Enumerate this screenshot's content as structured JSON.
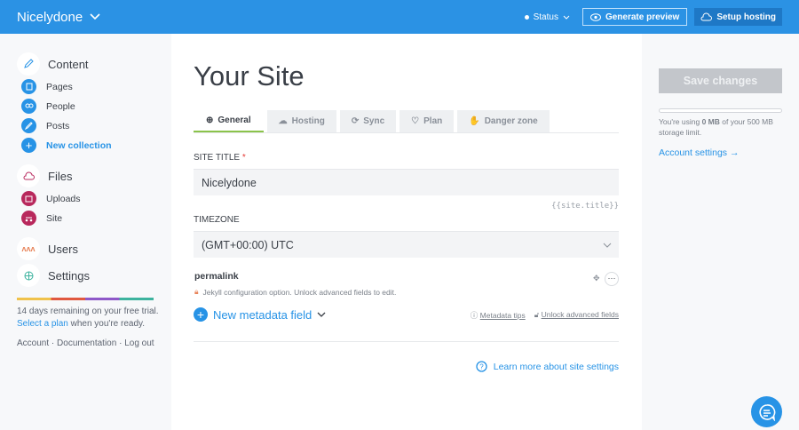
{
  "header": {
    "site_name": "Nicelydone",
    "status": "Status",
    "generate_preview": "Generate preview",
    "setup_hosting": "Setup hosting"
  },
  "sidebar": {
    "content": "Content",
    "pages": "Pages",
    "people": "People",
    "posts": "Posts",
    "new_collection": "New collection",
    "files": "Files",
    "uploads": "Uploads",
    "site": "Site",
    "users": "Users",
    "settings": "Settings",
    "trial_text": "14 days remaining on your free trial.",
    "select_plan": "Select a plan",
    "trial_suffix": " when you're ready.",
    "account": "Account",
    "documentation": "Documentation",
    "logout": "Log out",
    "sep": "·"
  },
  "main": {
    "title": "Your Site",
    "tabs": [
      "General",
      "Hosting",
      "Sync",
      "Plan",
      "Danger zone"
    ],
    "site_title_label": "SITE TITLE",
    "required": "*",
    "site_title_value": "Nicelydone",
    "site_title_hint": "{{site.title}}",
    "timezone_label": "TIMEZONE",
    "timezone_value": "(GMT+00:00) UTC",
    "permalink": "permalink",
    "permalink_note": "Jekyll configuration option. Unlock advanced fields to edit.",
    "more": "···",
    "new_metadata": "New metadata field",
    "metadata_tips": "Metadata tips",
    "unlock_advanced": "Unlock advanced fields",
    "learn_more": "Learn more about site settings"
  },
  "right": {
    "save": "Save changes",
    "usage_pre": "You're using ",
    "usage_amount": "0 MB",
    "usage_post": " of your 500 MB storage limit.",
    "storage_used_fraction": 0,
    "account_settings": "Account settings →"
  },
  "colors": {
    "brand": "#2b92e4",
    "accent": "#2793e6",
    "files": "#b8285c",
    "tab_active": "#8bc34a"
  }
}
